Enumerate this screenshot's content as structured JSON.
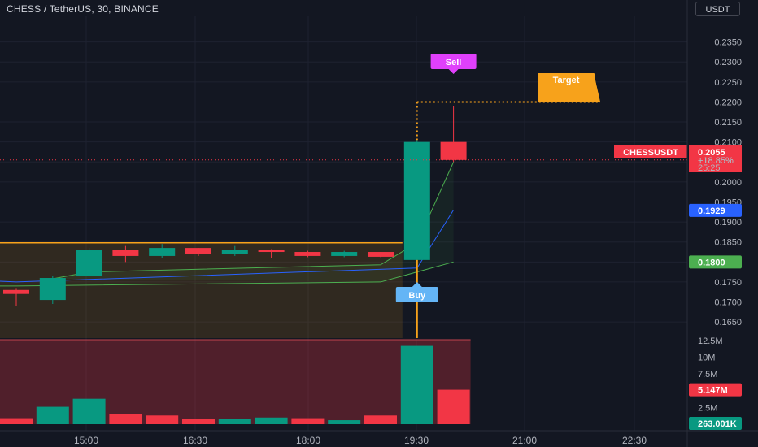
{
  "header": {
    "symbol_title": "CHESS / TetherUS, 30, BINANCE",
    "currency_button": "USDT"
  },
  "badges": {
    "sell": "Sell",
    "buy": "Buy",
    "target": "Target",
    "symbol_tag": "CHESSUSDT",
    "last_price": "0.2055",
    "change_pct": "+18.85%",
    "countdown": "25:25",
    "blue_level": "0.1929",
    "green_level": "0.1800",
    "volume_red": "5.147M",
    "volume_green": "263.001K"
  },
  "colors": {
    "up": "#089981",
    "down": "#f23645",
    "orange": "#f7a21b",
    "sell_badge": "#e040fb",
    "buy_badge": "#64b5f6",
    "blue_line": "#2962ff",
    "green_line": "#4caf50"
  },
  "chart_data": {
    "type": "candlestick",
    "x_ticks": [
      "15:00",
      "16:30",
      "18:00",
      "19:30",
      "21:00",
      "22:30"
    ],
    "price_ticks": [
      "0.2350",
      "0.2300",
      "0.2250",
      "0.2200",
      "0.2150",
      "0.2100",
      "0.2050",
      "0.2000",
      "0.1950",
      "0.1900",
      "0.1850",
      "0.1800",
      "0.1750",
      "0.1700",
      "0.1650"
    ],
    "volume_ticks": [
      "12.5M",
      "10M",
      "7.5M",
      "5M",
      "2.5M"
    ],
    "price_range": [
      0.163,
      0.24
    ],
    "volume_range": [
      0,
      12.5
    ],
    "candles": [
      {
        "o": 0.173,
        "h": 0.1735,
        "l": 0.169,
        "c": 0.172
      },
      {
        "o": 0.1705,
        "h": 0.1765,
        "l": 0.1695,
        "c": 0.176
      },
      {
        "o": 0.1765,
        "h": 0.1835,
        "l": 0.1765,
        "c": 0.183
      },
      {
        "o": 0.183,
        "h": 0.184,
        "l": 0.18,
        "c": 0.1815
      },
      {
        "o": 0.1815,
        "h": 0.1845,
        "l": 0.181,
        "c": 0.1835
      },
      {
        "o": 0.1835,
        "h": 0.1835,
        "l": 0.1815,
        "c": 0.182
      },
      {
        "o": 0.182,
        "h": 0.184,
        "l": 0.1815,
        "c": 0.183
      },
      {
        "o": 0.183,
        "h": 0.1832,
        "l": 0.181,
        "c": 0.1825
      },
      {
        "o": 0.1825,
        "h": 0.1828,
        "l": 0.1812,
        "c": 0.1815
      },
      {
        "o": 0.1815,
        "h": 0.1828,
        "l": 0.1812,
        "c": 0.1825
      },
      {
        "o": 0.1825,
        "h": 0.1825,
        "l": 0.1812,
        "c": 0.1813
      },
      {
        "o": 0.1805,
        "h": 0.2105,
        "l": 0.1805,
        "c": 0.21
      },
      {
        "o": 0.21,
        "h": 0.219,
        "l": 0.205,
        "c": 0.2055
      }
    ],
    "volumes": [
      {
        "v": 0.9,
        "up": false
      },
      {
        "v": 2.6,
        "up": true
      },
      {
        "v": 3.8,
        "up": true
      },
      {
        "v": 1.5,
        "up": false
      },
      {
        "v": 1.3,
        "up": false
      },
      {
        "v": 0.8,
        "up": false
      },
      {
        "v": 0.8,
        "up": true
      },
      {
        "v": 1.0,
        "up": true
      },
      {
        "v": 0.9,
        "up": false
      },
      {
        "v": 0.6,
        "up": true
      },
      {
        "v": 1.3,
        "up": false
      },
      {
        "v": 11.7,
        "up": true
      },
      {
        "v": 5.147,
        "up": false
      }
    ],
    "orange_band_level": 0.1848,
    "target_price": 0.22,
    "lines": {
      "blue": [
        [
          0,
          0.175
        ],
        [
          11,
          0.1785
        ],
        [
          12,
          0.193
        ]
      ],
      "green_lower": [
        [
          0,
          0.174
        ],
        [
          10,
          0.175
        ],
        [
          11,
          0.1775
        ],
        [
          12,
          0.18
        ]
      ],
      "green_upper": [
        [
          1,
          0.1758
        ],
        [
          2,
          0.1775
        ],
        [
          10,
          0.1793
        ],
        [
          11,
          0.1848
        ],
        [
          12,
          0.205
        ]
      ]
    }
  }
}
